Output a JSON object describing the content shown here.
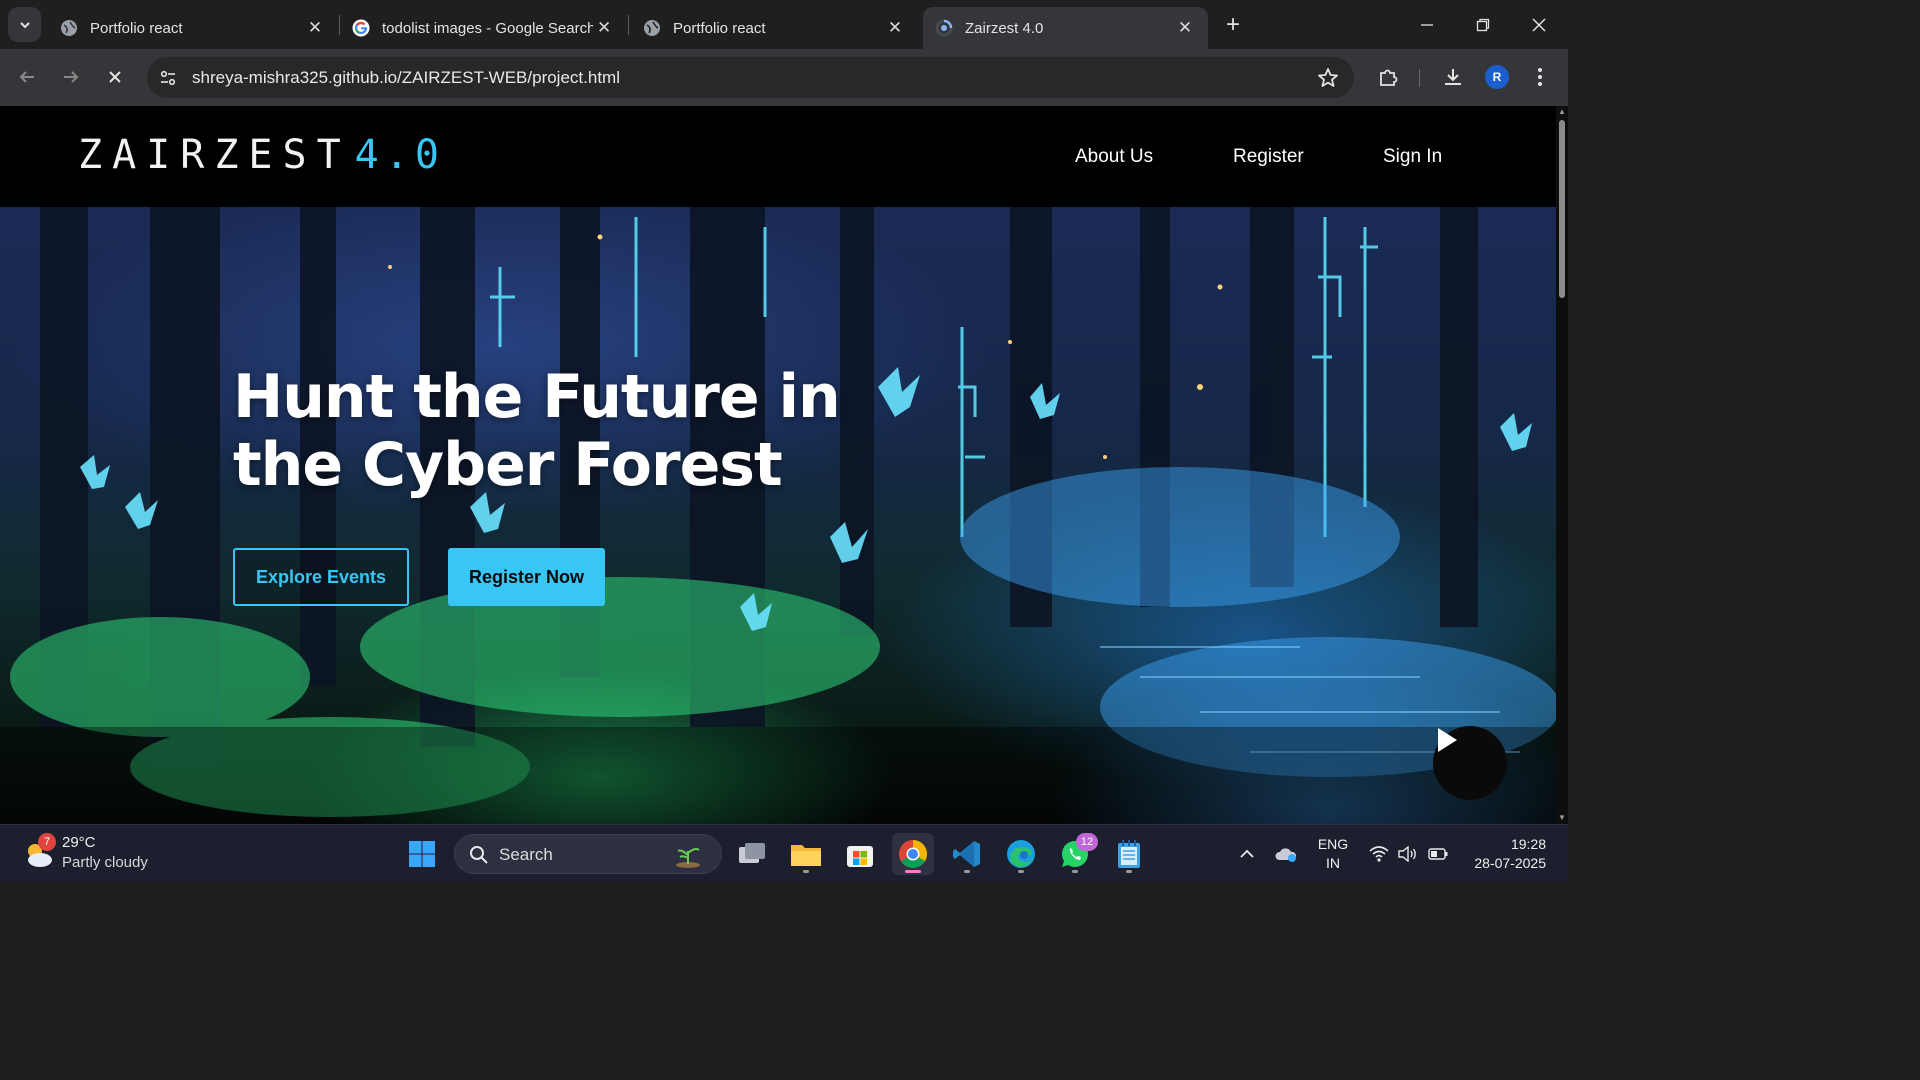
{
  "browser": {
    "tabs": [
      {
        "title": "Portfolio react",
        "favicon": "globe-icon",
        "active": false
      },
      {
        "title": "todolist images - Google Search",
        "favicon": "google-icon",
        "active": false
      },
      {
        "title": "Portfolio react",
        "favicon": "globe-icon",
        "active": false
      },
      {
        "title": "Zairzest 4.0",
        "favicon": "loading-spinner-icon",
        "active": true
      }
    ],
    "url": "shreya-mishra325.github.io/ZAIRZEST-WEB/project.html",
    "profile_initial": "R"
  },
  "site": {
    "logo_main": "ZAIRZEST",
    "logo_version": "4.0",
    "nav": [
      "About Us",
      "Register",
      "Sign In"
    ],
    "hero_title": "Hunt the Future in the Cyber Forest",
    "buttons": {
      "explore": "Explore Events",
      "register": "Register Now"
    },
    "accent_color": "#38c6f4"
  },
  "taskbar": {
    "weather": {
      "badge": "7",
      "temp": "29°C",
      "desc": "Partly cloudy"
    },
    "search_label": "Search",
    "apps": [
      "windows-start-icon",
      "task-view-icon",
      "file-explorer-icon",
      "microsoft-store-icon",
      "chrome-icon",
      "vscode-icon",
      "edge-icon",
      "whatsapp-icon",
      "notepad-icon"
    ],
    "whatsapp_badge": "12",
    "lang": {
      "line1": "ENG",
      "line2": "IN"
    },
    "time": "19:28",
    "date": "28-07-2025"
  }
}
